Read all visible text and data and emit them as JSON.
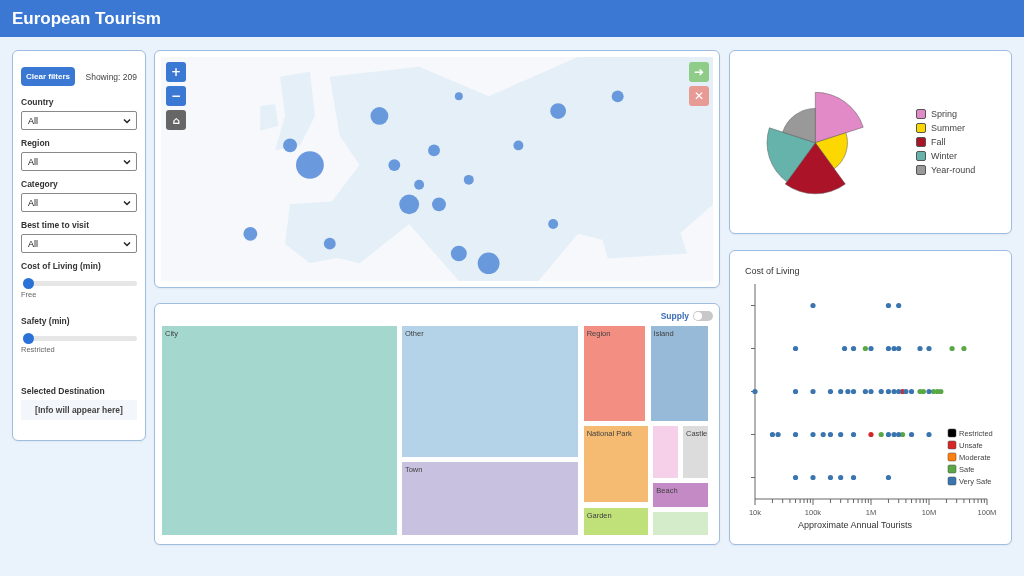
{
  "header": {
    "title": "European Tourism"
  },
  "filters": {
    "clear_button": "Clear filters",
    "showing": "Showing: 209",
    "dropdowns": [
      {
        "label": "Country",
        "value": "All"
      },
      {
        "label": "Region",
        "value": "All"
      },
      {
        "label": "Category",
        "value": "All"
      },
      {
        "label": "Best time to visit",
        "value": "All"
      }
    ],
    "sliders": [
      {
        "label": "Cost of Living (min)",
        "level": 0.05,
        "caption": "Free"
      },
      {
        "label": "Safety (min)",
        "level": 0.05,
        "caption": "Restricted"
      }
    ],
    "selected_destination": {
      "title": "Selected Destination",
      "info": "[Info will appear here]"
    }
  },
  "map": {
    "zoom_in": "+",
    "zoom_out": "−",
    "home": "⌂",
    "go": "➜",
    "close": "✕"
  },
  "treemap": {
    "supply_label": "Supply",
    "supply_on": false,
    "tiles": [
      {
        "label": "City",
        "color": "#a4d8cf"
      },
      {
        "label": "Other",
        "color": "#b4d3e8"
      },
      {
        "label": "Town",
        "color": "#c8c2e0"
      },
      {
        "label": "Region",
        "color": "#f38f82"
      },
      {
        "label": "Island",
        "color": "#97bad8"
      },
      {
        "label": "National Park",
        "color": "#f5bb72"
      },
      {
        "label": "Garden",
        "color": "#c0e07a"
      },
      {
        "color": "#f6d0e8"
      },
      {
        "label": "Castle",
        "color": "#dcdcdc"
      },
      {
        "label": "Beach",
        "color": "#c48ac5"
      },
      {
        "color": "#d4ecc9"
      }
    ]
  },
  "season_legend": [
    {
      "label": "Spring",
      "color": "#e28ac7"
    },
    {
      "label": "Summer",
      "color": "#fcd800"
    },
    {
      "label": "Fall",
      "color": "#ab1428"
    },
    {
      "label": "Winter",
      "color": "#65b3ab"
    },
    {
      "label": "Year-round",
      "color": "#999999"
    }
  ],
  "scatter": {
    "title": "Cost of Living",
    "xlabel": "Approximate Annual Tourists",
    "tick_labels": [
      "10k",
      "100k",
      "1M",
      "10M",
      "100M"
    ],
    "legend": [
      {
        "label": "Restricted",
        "color": "#000000"
      },
      {
        "label": "Unsafe",
        "color": "#d62728"
      },
      {
        "label": "Moderate",
        "color": "#ff7f0e"
      },
      {
        "label": "Safe",
        "color": "#5aa845"
      },
      {
        "label": "Very Safe",
        "color": "#3a75b0"
      }
    ]
  }
}
